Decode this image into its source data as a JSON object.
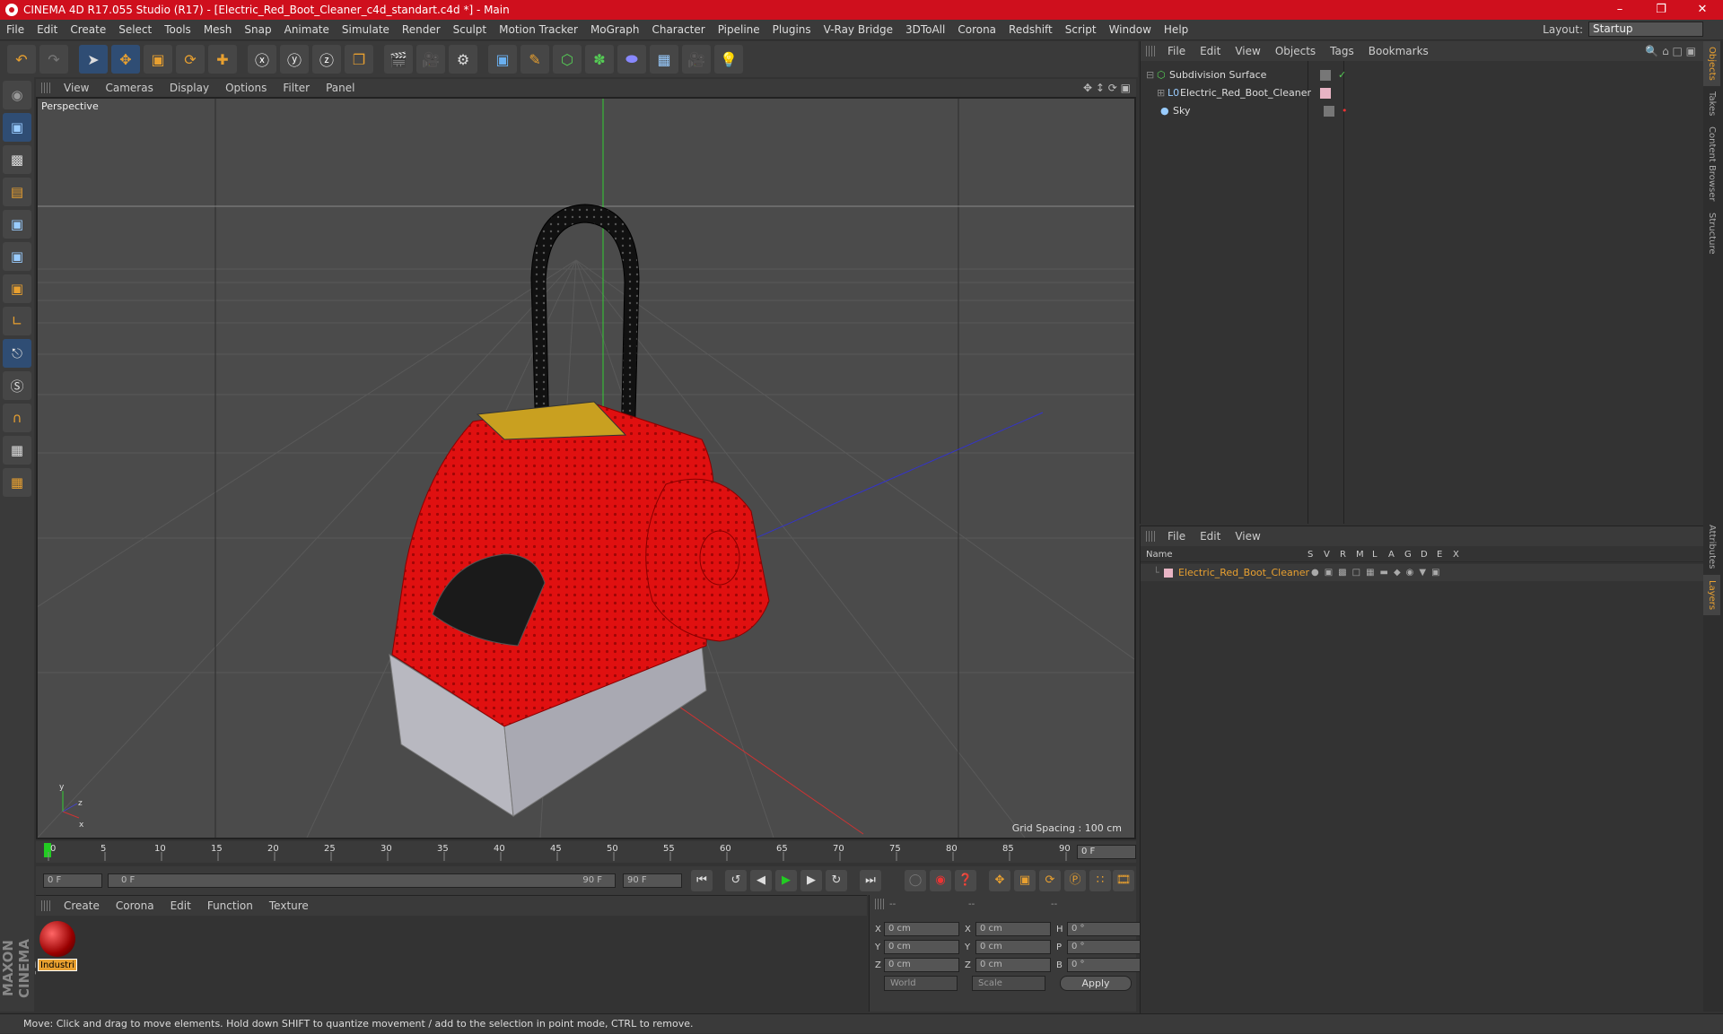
{
  "window": {
    "title": "CINEMA 4D R17.055 Studio (R17) - [Electric_Red_Boot_Cleaner_c4d_standart.c4d *] - Main"
  },
  "menubar": {
    "items": [
      "File",
      "Edit",
      "Create",
      "Select",
      "Tools",
      "Mesh",
      "Snap",
      "Animate",
      "Simulate",
      "Render",
      "Sculpt",
      "Motion Tracker",
      "MoGraph",
      "Character",
      "Pipeline",
      "Plugins",
      "V-Ray Bridge",
      "3DToAll",
      "Corona",
      "Redshift",
      "Script",
      "Window",
      "Help"
    ]
  },
  "layout": {
    "label": "Layout:",
    "value": "Startup"
  },
  "viewport": {
    "menu": [
      "View",
      "Cameras",
      "Display",
      "Options",
      "Filter",
      "Panel"
    ],
    "label": "Perspective",
    "grid_spacing": "Grid Spacing : 100 cm"
  },
  "timeline": {
    "ticks": [
      "0",
      "5",
      "10",
      "15",
      "20",
      "25",
      "30",
      "35",
      "40",
      "45",
      "50",
      "55",
      "60",
      "65",
      "70",
      "75",
      "80",
      "85",
      "90"
    ],
    "current_frame": "0 F",
    "start_field": "0 F",
    "range_start": "0 F",
    "range_end": "90 F",
    "end_field": "90 F"
  },
  "materials": {
    "menu": [
      "Create",
      "Corona",
      "Edit",
      "Function",
      "Texture"
    ],
    "item_label": "Industri"
  },
  "coords": {
    "headers": [
      "--",
      "--",
      "--"
    ],
    "rows": [
      {
        "a": "X",
        "av": "0 cm",
        "b": "X",
        "bv": "0 cm",
        "c": "H",
        "cv": "0 °"
      },
      {
        "a": "Y",
        "av": "0 cm",
        "b": "Y",
        "bv": "0 cm",
        "c": "P",
        "cv": "0 °"
      },
      {
        "a": "Z",
        "av": "0 cm",
        "b": "Z",
        "bv": "0 cm",
        "c": "B",
        "cv": "0 °"
      }
    ],
    "world": "World",
    "scale": "Scale",
    "apply": "Apply"
  },
  "objects": {
    "menu": [
      "File",
      "Edit",
      "View",
      "Objects",
      "Tags",
      "Bookmarks"
    ],
    "items": [
      "Subdivision Surface",
      "Electric_Red_Boot_Cleaner",
      "Sky"
    ]
  },
  "layers": {
    "menu": [
      "File",
      "Edit",
      "View"
    ],
    "columns": [
      "Name",
      "S",
      "V",
      "R",
      "M",
      "L",
      "A",
      "G",
      "D",
      "E",
      "X"
    ],
    "item": "Electric_Red_Boot_Cleaner"
  },
  "sidetabs": [
    "Objects",
    "Takes",
    "Content Browser",
    "Structure",
    "Attributes",
    "Layers"
  ],
  "maxon": "MAXON CINEMA 4D",
  "status": "Move: Click and drag to move elements. Hold down SHIFT to quantize movement / add to the selection in point mode, CTRL to remove.",
  "colors": {
    "title_bar": "#cf0f1d",
    "accent": "#e8a030",
    "selected_tool": "#2f4d74"
  }
}
